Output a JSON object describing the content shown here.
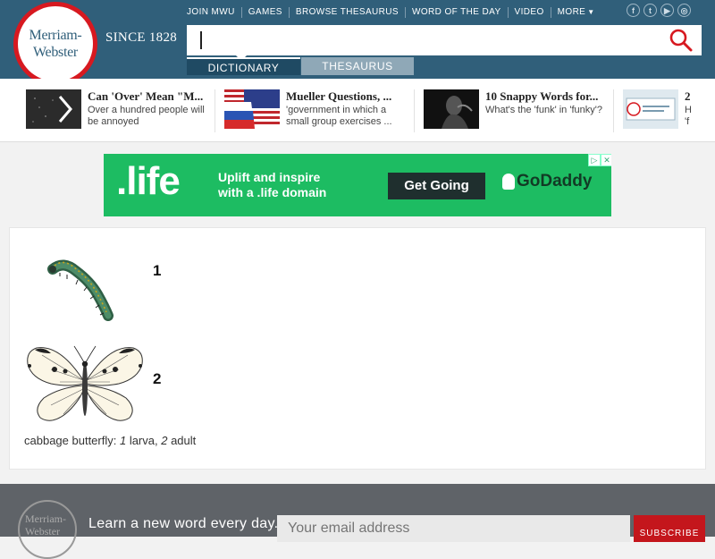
{
  "header": {
    "logo_line1": "Merriam-",
    "logo_line2": "Webster",
    "since": "SINCE 1828",
    "nav": [
      "JOIN MWU",
      "GAMES",
      "BROWSE THESAURUS",
      "WORD OF THE DAY",
      "VIDEO",
      "MORE"
    ],
    "social": [
      {
        "name": "facebook-icon",
        "glyph": "f"
      },
      {
        "name": "twitter-icon",
        "glyph": "t"
      },
      {
        "name": "youtube-icon",
        "glyph": "▶"
      },
      {
        "name": "instagram-icon",
        "glyph": "◎"
      }
    ],
    "search_value": "",
    "tab_dictionary": "DICTIONARY",
    "tab_thesaurus": "THESAURUS",
    "brand_color": "#305f7a",
    "brand_red": "#d71920"
  },
  "trending": [
    {
      "title": "Can 'Over' Mean \"M...",
      "desc": "Over a hundred people will be annoyed"
    },
    {
      "title": "Mueller Questions, ...",
      "desc": "'government in which a small group exercises ..."
    },
    {
      "title": "10 Snappy Words for...",
      "desc": "What's the 'funk' in 'funky'?"
    },
    {
      "title": "2",
      "desc": "H 'f"
    }
  ],
  "ad": {
    "life": ".life",
    "line1": "Uplift and inspire",
    "line2": "with a .life domain",
    "button": "Get Going",
    "brand": "GoDaddy",
    "color": "#1dbc62"
  },
  "figure": {
    "label1": "1",
    "label2": "2",
    "caption_prefix": "cabbage butterfly: ",
    "caption_n1": "1",
    "caption_mid": " larva, ",
    "caption_n2": "2",
    "caption_end": " adult"
  },
  "footer": {
    "logo_line1": "Merriam-",
    "logo_line2": "Webster",
    "text": "Learn a new word every day.",
    "email_placeholder": "Your email address",
    "subscribe": "SUBSCRIBE"
  }
}
